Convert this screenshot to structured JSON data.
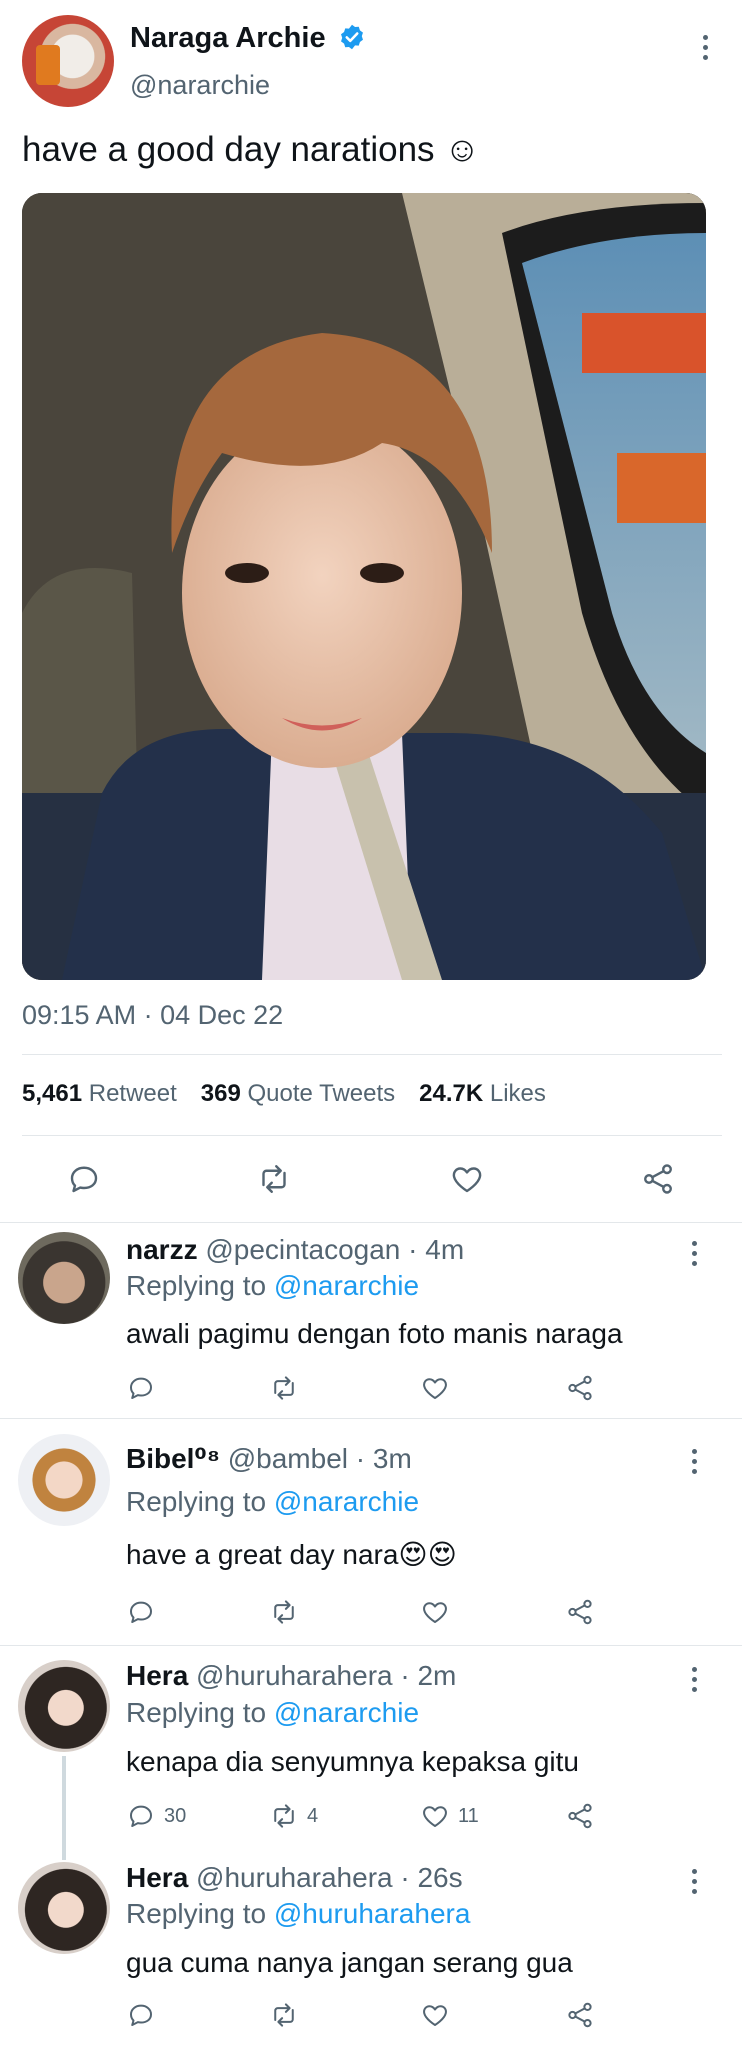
{
  "main_tweet": {
    "author_name": "Naraga Archie",
    "handle": "@nararchie",
    "text": "have a good day narations ☺",
    "timestamp": "09:15 AM · 04 Dec 22",
    "stats": [
      {
        "value": "5,461",
        "label": "Retweet"
      },
      {
        "value": "369",
        "label": "Quote Tweets"
      },
      {
        "value": "24.7K",
        "label": "Likes"
      }
    ]
  },
  "replies": [
    {
      "name": "narzz",
      "meta": "@pecintacogan · 4m",
      "replying_prefix": "Replying to",
      "replying_to": "@nararchie",
      "text": "awali pagimu dengan foto manis naraga",
      "reply_count": "",
      "retweet_count": "",
      "like_count": ""
    },
    {
      "name": "Bibel⁰⁸",
      "meta": "@bambel · 3m",
      "replying_prefix": "Replying to",
      "replying_to": "@nararchie",
      "text": "have a great day nara😍😍",
      "reply_count": "",
      "retweet_count": "",
      "like_count": ""
    },
    {
      "name": "Hera",
      "meta": "@huruharahera · 2m",
      "replying_prefix": "Replying to",
      "replying_to": "@nararchie",
      "text": "kenapa dia senyumnya kepaksa gitu",
      "reply_count": "30",
      "retweet_count": "4",
      "like_count": "11"
    },
    {
      "name": "Hera",
      "meta": "@huruharahera · 26s",
      "replying_prefix": "Replying to",
      "replying_to": "@huruharahera",
      "text": "gua cuma nanya jangan serang gua",
      "reply_count": "",
      "retweet_count": "",
      "like_count": ""
    }
  ],
  "colors": {
    "accent": "#1d9bf0",
    "muted": "#536471",
    "divider": "#e3e7ea"
  }
}
